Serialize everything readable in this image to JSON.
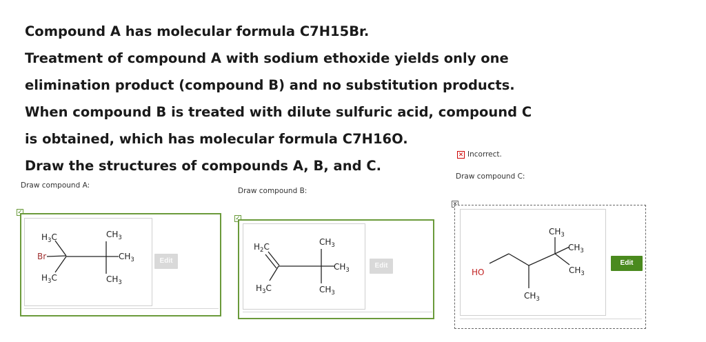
{
  "question": {
    "lines": [
      "Compound A has molecular formula C7H15Br.",
      "Treatment of compound A with sodium ethoxide yields only one",
      "elimination product (compound B) and no substitution products.",
      "When compound B is treated with dilute sulfuric acid, compound C",
      "is obtained, which has molecular formula C7H16O.",
      "Draw the structures of compounds A, B, and C."
    ]
  },
  "compound_a": {
    "label": "Draw compound A:",
    "edit_label": "Edit",
    "status": "correct",
    "atoms": {
      "h3c_top": "H",
      "h3c_top_sub": "3",
      "h3c_top_c": "C",
      "br": "Br",
      "ch3_top": "CH",
      "ch3_top_sub": "3",
      "ch3_right": "CH",
      "ch3_right_sub": "3",
      "h3c_bot": "H",
      "h3c_bot_sub": "3",
      "h3c_bot_c": "C",
      "ch3_bot": "CH",
      "ch3_bot_sub": "3"
    }
  },
  "compound_b": {
    "label": "Draw compound B:",
    "edit_label": "Edit",
    "status": "correct",
    "atoms": {
      "h2c": "H",
      "h2c_sub": "2",
      "h2c_c": "C",
      "ch3_top": "CH",
      "ch3_top_sub": "3",
      "ch3_right": "CH",
      "ch3_right_sub": "3",
      "h3c_bot": "H",
      "h3c_bot_sub": "3",
      "h3c_bot_c": "C",
      "ch3_bot": "CH",
      "ch3_bot_sub": "3"
    }
  },
  "compound_c": {
    "label": "Draw compound C:",
    "edit_label": "Edit",
    "status_text": "Incorrect.",
    "status_icon": "x",
    "atoms": {
      "ho": "HO",
      "ch3_top": "CH",
      "ch3_top_sub": "3",
      "ch3_mid": "CH",
      "ch3_mid_sub": "3",
      "ch3_low": "CH",
      "ch3_low_sub": "3",
      "ch3_bot": "CH",
      "ch3_bot_sub": "3"
    }
  },
  "colors": {
    "panel_border": "#6a9a3a",
    "edit_active": "#4a8a1e",
    "edit_disabled": "#d9d9d9",
    "incorrect": "#cc0000",
    "hydroxyl": "#c02020"
  }
}
